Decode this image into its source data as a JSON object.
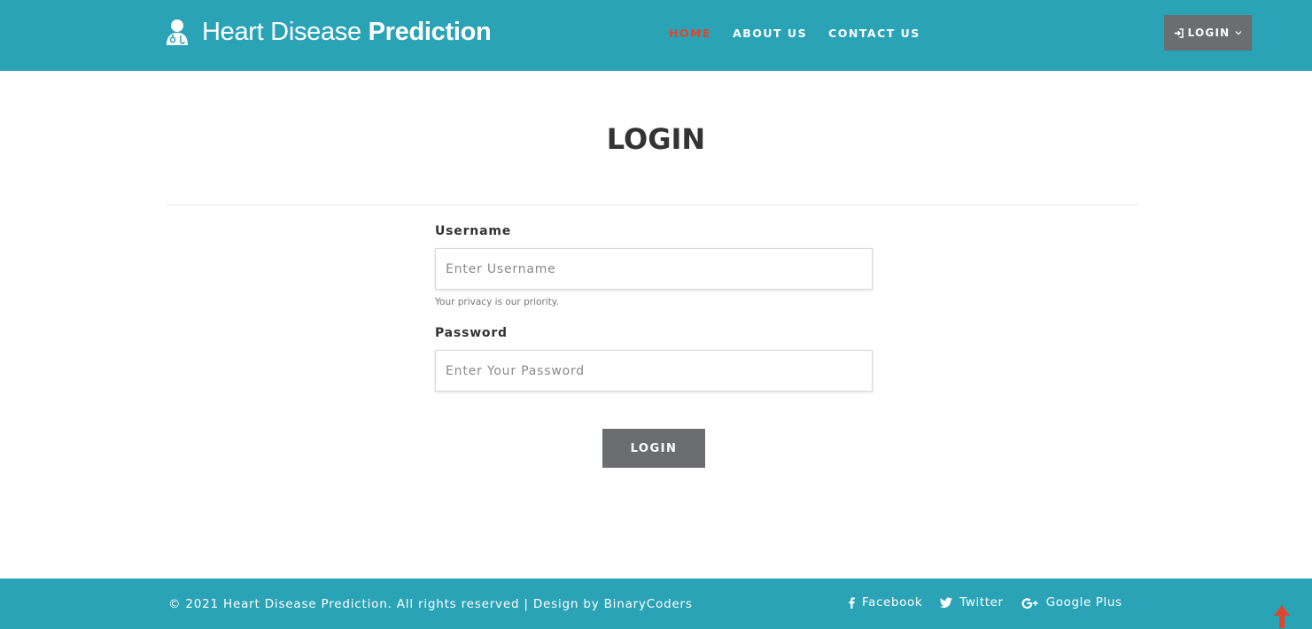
{
  "brand": {
    "icon": "doctor-user-icon",
    "title_light": "Heart Disease",
    "title_bold": "Prediction"
  },
  "nav": {
    "items": [
      {
        "label": "HOME",
        "active": true
      },
      {
        "label": "ABOUT US",
        "active": false
      },
      {
        "label": "CONTACT US",
        "active": false
      }
    ]
  },
  "header_login": {
    "icon": "sign-in-icon",
    "label": "LOGIN",
    "caret": "chevron-down-icon"
  },
  "page": {
    "title": "LOGIN"
  },
  "form": {
    "username_label": "Username",
    "username_placeholder": "Enter Username",
    "username_help": "Your privacy is our priority.",
    "password_label": "Password",
    "password_placeholder": "Enter Your Password",
    "submit_label": "LOGIN"
  },
  "footer": {
    "copyright": "© 2021 Heart Disease Prediction. All rights reserved | Design by BinaryCoders",
    "social": [
      {
        "icon": "facebook-icon",
        "label": "Facebook"
      },
      {
        "icon": "twitter-icon",
        "label": "Twitter"
      },
      {
        "icon": "google-plus-icon",
        "label": "Google Plus"
      }
    ]
  },
  "scroll_top": {
    "icon": "arrow-up-icon"
  },
  "colors": {
    "brand": "#2ba3b7",
    "active_nav": "#e0452b",
    "button": "#6b6d6f",
    "heading": "#333333"
  }
}
